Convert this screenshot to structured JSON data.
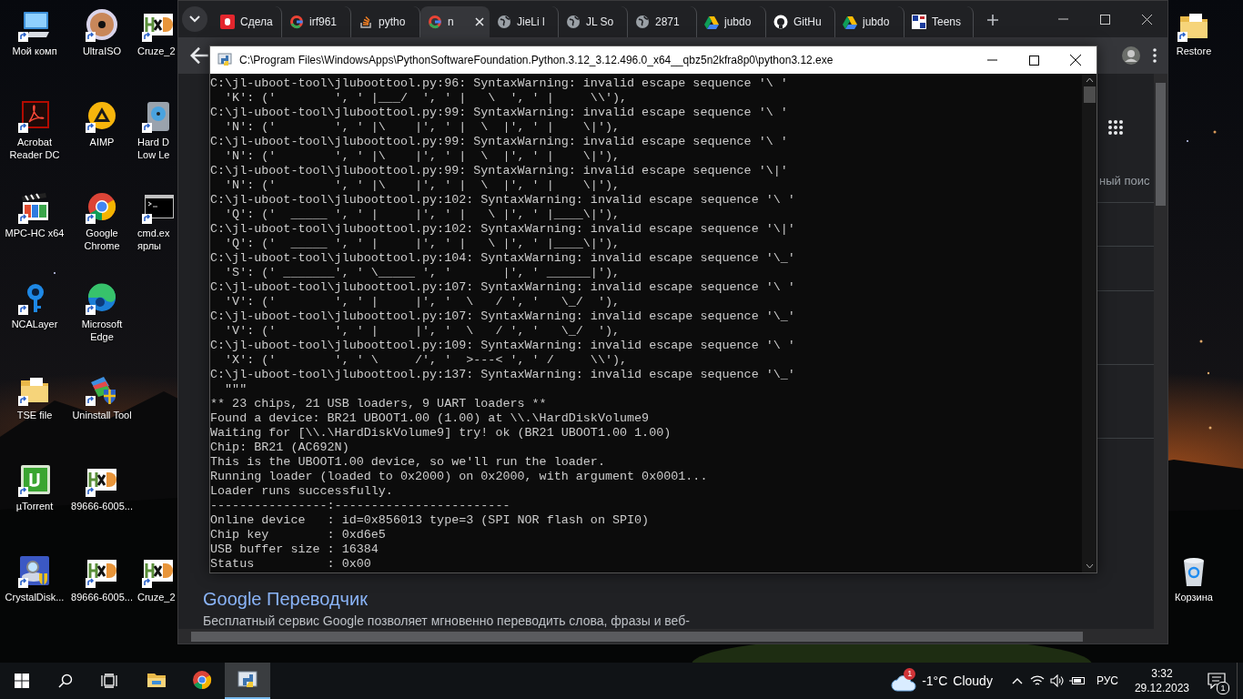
{
  "desktop": {
    "columns": [
      [
        {
          "kind": "computer",
          "label": "Мой комп"
        },
        {
          "kind": "pdf",
          "label": "Acrobat Reader DC"
        },
        {
          "kind": "mpc",
          "label": "MPC-HC x64"
        },
        {
          "kind": "ncalayer",
          "label": "NCALayer"
        },
        {
          "kind": "folder",
          "label": "TSE file"
        },
        {
          "kind": "utorrent",
          "label": "µTorrent"
        },
        {
          "kind": "crystaldisk",
          "label": "CrystalDisk..."
        }
      ],
      [
        {
          "kind": "ultraiso",
          "label": "UltraISO"
        },
        {
          "kind": "aimp",
          "label": "AIMP"
        },
        {
          "kind": "chrome",
          "label": "Google Chrome"
        },
        {
          "kind": "edge",
          "label": "Microsoft Edge"
        },
        {
          "kind": "uninstall",
          "label": "Uninstall Tool"
        },
        {
          "kind": "hxd",
          "label": "89666-6005..."
        },
        {
          "kind": "hxd",
          "label": "89666-6005..."
        }
      ],
      [
        {
          "kind": "hxd",
          "label": "Cruze_2"
        },
        {
          "kind": "hdd",
          "label": "Hard D Low Le"
        },
        {
          "kind": "cmd",
          "label": "cmd.ex ярлы"
        },
        {
          "kind": "hxd",
          "label": "Cruze_2"
        }
      ]
    ],
    "right_icons": [
      {
        "kind": "folder",
        "label": "Restore"
      },
      {
        "kind": "recycle",
        "label": "Корзина"
      }
    ]
  },
  "browser": {
    "tabs": [
      {
        "kind": "d",
        "label": "Сдела",
        "selected": false
      },
      {
        "kind": "g",
        "label": "irf961",
        "selected": false
      },
      {
        "kind": "stack",
        "label": "pytho",
        "selected": false
      },
      {
        "kind": "g",
        "label": "n",
        "selected": true
      },
      {
        "kind": "globe",
        "label": "JieLi l",
        "selected": false
      },
      {
        "kind": "globe",
        "label": "JL So",
        "selected": false
      },
      {
        "kind": "globe",
        "label": "2871",
        "selected": false
      },
      {
        "kind": "drive",
        "label": "jubdo",
        "selected": false
      },
      {
        "kind": "github",
        "label": "GitHu",
        "selected": false
      },
      {
        "kind": "drive",
        "label": "jubdo",
        "selected": false
      },
      {
        "kind": "pjrc",
        "label": "Teens",
        "selected": false
      }
    ],
    "search_tab_text": "ный поис",
    "result": {
      "title": "Google Переводчик",
      "description": "Бесплатный сервис Google позволяет мгновенно переводить слова, фразы и веб-"
    }
  },
  "console": {
    "title": "C:\\Program Files\\WindowsApps\\PythonSoftwareFoundation.Python.3.12_3.12.496.0_x64__qbz5n2kfra8p0\\python3.12.exe",
    "lines": [
      "C:\\jl-uboot-tool\\jluboottool.py:96: SyntaxWarning: invalid escape sequence '\\ '",
      "  'K': ('        ', ' |___/  ', ' |   \\  ', ' |     \\\\'),",
      "C:\\jl-uboot-tool\\jluboottool.py:99: SyntaxWarning: invalid escape sequence '\\ '",
      "  'N': ('        ', ' |\\    |', ' |  \\  |', ' |    \\|'),",
      "C:\\jl-uboot-tool\\jluboottool.py:99: SyntaxWarning: invalid escape sequence '\\ '",
      "  'N': ('        ', ' |\\    |', ' |  \\  |', ' |    \\|'),",
      "C:\\jl-uboot-tool\\jluboottool.py:99: SyntaxWarning: invalid escape sequence '\\|'",
      "  'N': ('        ', ' |\\    |', ' |  \\  |', ' |    \\|'),",
      "C:\\jl-uboot-tool\\jluboottool.py:102: SyntaxWarning: invalid escape sequence '\\ '",
      "  'Q': ('  _____ ', ' |     |', ' |   \\ |', ' |____\\|'),",
      "C:\\jl-uboot-tool\\jluboottool.py:102: SyntaxWarning: invalid escape sequence '\\|'",
      "  'Q': ('  _____ ', ' |     |', ' |   \\ |', ' |____\\|'),",
      "C:\\jl-uboot-tool\\jluboottool.py:104: SyntaxWarning: invalid escape sequence '\\_'",
      "  'S': (' _______', ' \\_____ ', '       |', ' ______|'),",
      "C:\\jl-uboot-tool\\jluboottool.py:107: SyntaxWarning: invalid escape sequence '\\ '",
      "  'V': ('        ', ' |     |', '  \\   / ', '   \\_/  '),",
      "C:\\jl-uboot-tool\\jluboottool.py:107: SyntaxWarning: invalid escape sequence '\\_'",
      "  'V': ('        ', ' |     |', '  \\   / ', '   \\_/  '),",
      "C:\\jl-uboot-tool\\jluboottool.py:109: SyntaxWarning: invalid escape sequence '\\ '",
      "  'X': ('        ', ' \\     /', '  >---< ', ' /     \\\\'),",
      "C:\\jl-uboot-tool\\jluboottool.py:137: SyntaxWarning: invalid escape sequence '\\_'",
      "  \"\"\"",
      "** 23 chips, 21 USB loaders, 9 UART loaders **",
      "Found a device: BR21 UBOOT1.00 (1.00) at \\\\.\\HardDiskVolume9",
      "Waiting for [\\\\.\\HardDiskVolume9] try! ok (BR21 UBOOT1.00 1.00)",
      "Chip: BR21 (AC692N)",
      "This is the UBOOT1.00 device, so we'll run the loader.",
      "Running loader (loaded to 0x2000) on 0x2000, with argument 0x0001...",
      "Loader runs successfully.",
      "----------------:------------------------",
      "Online device   : id=0x856013 type=3 (SPI NOR flash on SPI0)",
      "Chip key        : 0xd6e5",
      "USB buffer size : 16384",
      "Status          : 0x00"
    ]
  },
  "taskbar": {
    "apps": [
      {
        "kind": "folder",
        "selected": false
      },
      {
        "kind": "chrome",
        "selected": false
      },
      {
        "kind": "python",
        "selected": true
      }
    ],
    "weather": {
      "badge": "1",
      "temperature": "-1°C",
      "condition": "Cloudy"
    },
    "language": "РУС",
    "time": "3:32",
    "date": "29.12.2023",
    "notification_count": "1"
  }
}
